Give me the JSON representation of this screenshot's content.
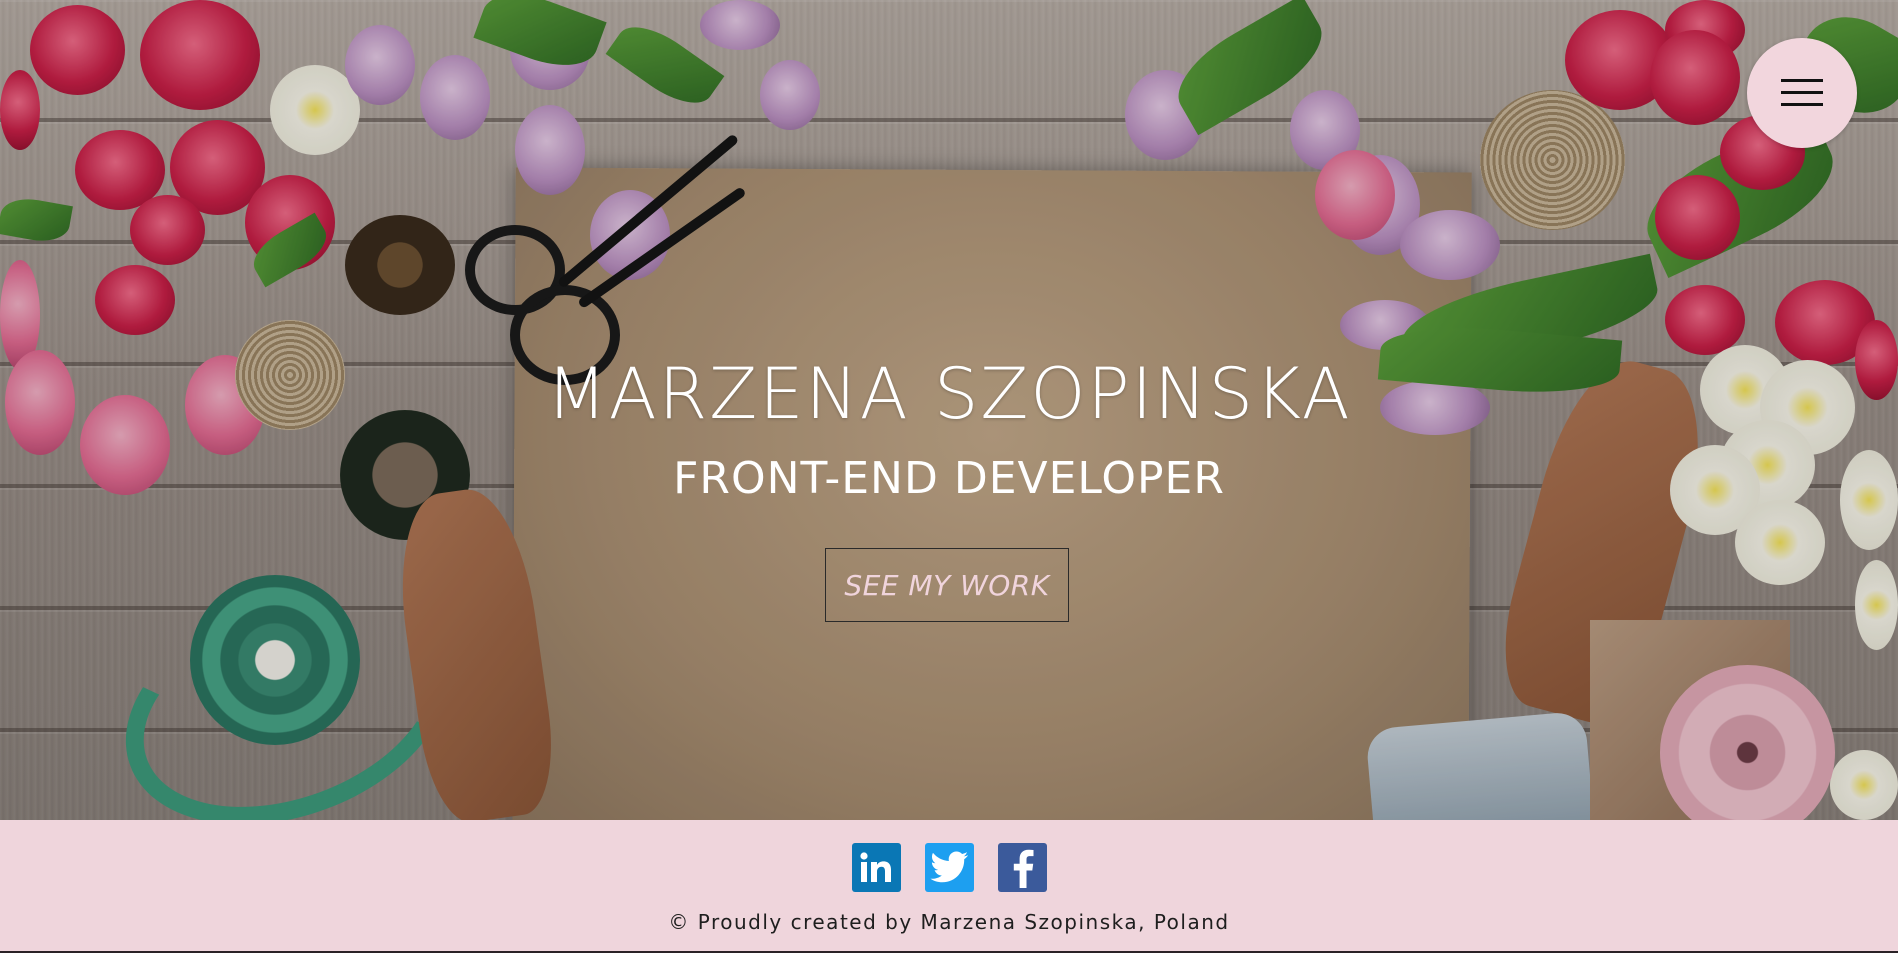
{
  "hero": {
    "name": "MARZENA SZOPINSKA",
    "title": "FRONT-END DEVELOPER",
    "cta_label": "SEE MY WORK"
  },
  "menu": {
    "icon": "hamburger-menu-icon"
  },
  "footer": {
    "social": [
      {
        "name": "linkedin",
        "icon": "linkedin-icon",
        "color": "#0a77b5"
      },
      {
        "name": "twitter",
        "icon": "twitter-icon",
        "color": "#1d9ff0"
      },
      {
        "name": "facebook",
        "icon": "facebook-icon",
        "color": "#3b5a9b"
      }
    ],
    "copyright": "© Proudly created by Marzena Szopinska, Poland"
  },
  "colors": {
    "footer_background": "#efd5dc",
    "menu_button": "#f2d6dd",
    "cta_text": "#f0d4dc"
  }
}
